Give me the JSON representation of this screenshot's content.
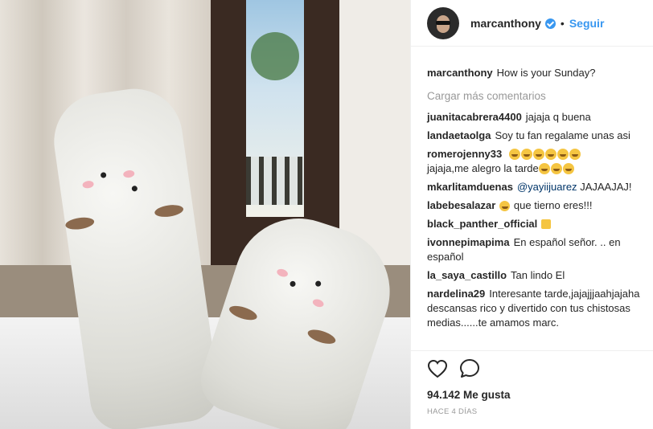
{
  "post": {
    "username": "marcanthony",
    "separator": "•",
    "follow_label": "Seguir",
    "caption_user": "marcanthony",
    "caption_text": "How is your Sunday?",
    "load_more": "Cargar más comentarios",
    "likes": "94.142 Me gusta",
    "time": "HACE 4 DÍAS"
  },
  "comments": [
    {
      "user": "juanitacabrera4400",
      "text": "jajaja q buena"
    },
    {
      "user": "landaetaolga",
      "text": "Soy tu fan regalame unas asi"
    },
    {
      "user": "romerojenny33",
      "text": "jajaja,me alegro la tarde"
    },
    {
      "user": "mkarlitamduenas",
      "mention": "@yayiijuarez",
      "text": "JAJAAJAJ!"
    },
    {
      "user": "labebesalazar",
      "text": "que tierno eres!!!"
    },
    {
      "user": "black_panther_official",
      "text": ""
    },
    {
      "user": "ivonnepimapima",
      "text": "En español señor. .. en español"
    },
    {
      "user": "la_saya_castillo",
      "text": "Tan lindo El"
    },
    {
      "user": "nardelina29",
      "text": "Interesante tarde,jajajjjaahjajaha descansas rico y divertido con tus chistosas medias......te amamos marc."
    }
  ],
  "icons": {
    "verified": "verified-badge-icon",
    "like": "heart-icon",
    "comment": "comment-bubble-icon"
  },
  "colors": {
    "link": "#3897f0",
    "muted": "#999999",
    "text": "#262626"
  }
}
